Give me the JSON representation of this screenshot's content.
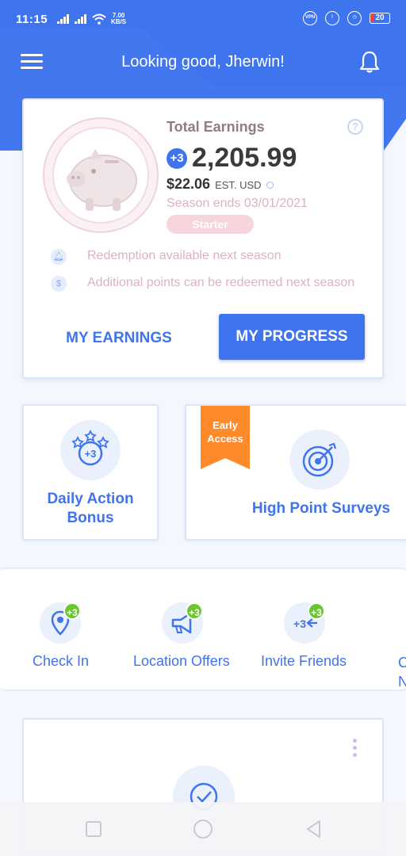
{
  "status_bar": {
    "time": "11:15",
    "net_speed_value": "7.00",
    "net_speed_unit": "KB/S",
    "vpn": "VPN",
    "battery": "20"
  },
  "header": {
    "greeting": "Looking good, Jherwin!",
    "menu_icon": "hamburger-menu-icon",
    "bell_icon": "bell-icon"
  },
  "earnings": {
    "title": "Total Earnings",
    "help": "?",
    "points": "2,205.99",
    "coin_symbol": "+3",
    "usd_value": "$22.06",
    "usd_label": "EST. USD",
    "season_end": "Season ends 03/01/2021",
    "tier": "Starter",
    "notes": [
      {
        "icon": "bell-icon",
        "text": "Redemption available next season"
      },
      {
        "icon": "dollar-icon",
        "text": "Additional points can be redeemed next season"
      }
    ],
    "my_earnings_label": "MY EARNINGS",
    "my_progress_label": "MY PROGRESS"
  },
  "features": {
    "daily": {
      "label_line1": "Daily Action",
      "label_line2": "Bonus",
      "icon": "stars-coin-icon"
    },
    "surveys": {
      "label": "High Point Surveys",
      "ribbon_line1": "Early",
      "ribbon_line2": "Access",
      "icon": "target-icon"
    }
  },
  "quick_actions": [
    {
      "label": "Check In",
      "badge": "+3",
      "icon": "location-pin-icon"
    },
    {
      "label": "Location Offers",
      "badge": "+3",
      "icon": "megaphone-icon"
    },
    {
      "label": "Invite Friends",
      "badge": "+3",
      "icon": "invite-arrows-icon"
    }
  ],
  "quick_partial": {
    "line1": "C",
    "line2": "N"
  },
  "colors": {
    "brand_blue": "#3f74ef",
    "badge_green": "#6bc52f",
    "ribbon_orange": "#ff8a2b",
    "muted_pink": "#dbb3bc"
  }
}
